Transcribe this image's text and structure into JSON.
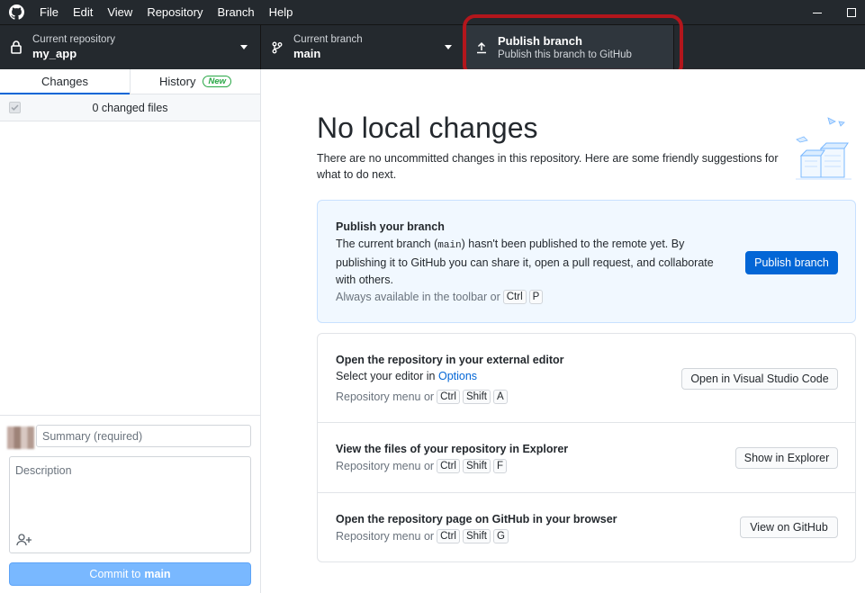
{
  "menu": {
    "items": [
      {
        "label": "File"
      },
      {
        "label": "Edit"
      },
      {
        "label": "View"
      },
      {
        "label": "Repository"
      },
      {
        "label": "Branch"
      },
      {
        "label": "Help"
      }
    ]
  },
  "toolbar": {
    "repo": {
      "desc": "Current repository",
      "title": "my_app"
    },
    "branch": {
      "desc": "Current branch",
      "title": "main"
    },
    "publish": {
      "title": "Publish branch",
      "desc": "Publish this branch to GitHub"
    }
  },
  "sidebar": {
    "tabs": [
      {
        "label": "Changes",
        "selected": true
      },
      {
        "label": "History",
        "badge": "New"
      }
    ],
    "changed_files": "0 changed files",
    "commit": {
      "summary_placeholder": "Summary (required)",
      "description_placeholder": "Description",
      "button_prefix": "Commit to",
      "button_branch": "main"
    }
  },
  "main": {
    "heading": "No local changes",
    "subtext": "There are no uncommitted changes in this repository. Here are some friendly suggestions for what to do next.",
    "publish_card": {
      "title": "Publish your branch",
      "body_1": "The current branch (",
      "branch_code": "main",
      "body_2": ") hasn't been published to the remote yet. By publishing it to GitHub you can share it, open a pull request, and collaborate with others.",
      "hint": "Always available in the toolbar or",
      "keys": [
        "Ctrl",
        "P"
      ],
      "button": "Publish branch"
    },
    "suggestions": [
      {
        "title": "Open the repository in your external editor",
        "line": "Select your editor in",
        "link": "Options",
        "hint": "Repository menu or",
        "keys": [
          "Ctrl",
          "Shift",
          "A"
        ],
        "button": "Open in Visual Studio Code"
      },
      {
        "title": "View the files of your repository in Explorer",
        "hint": "Repository menu or",
        "keys": [
          "Ctrl",
          "Shift",
          "F"
        ],
        "button": "Show in Explorer"
      },
      {
        "title": "Open the repository page on GitHub in your browser",
        "hint": "Repository menu or",
        "keys": [
          "Ctrl",
          "Shift",
          "G"
        ],
        "button": "View on GitHub"
      }
    ]
  },
  "colors": {
    "titlebar": "#24292e",
    "accent": "#0366d6",
    "commit_button": "#79b8ff",
    "highlight_ring": "#b3161c",
    "new_badge": "#28a745"
  }
}
